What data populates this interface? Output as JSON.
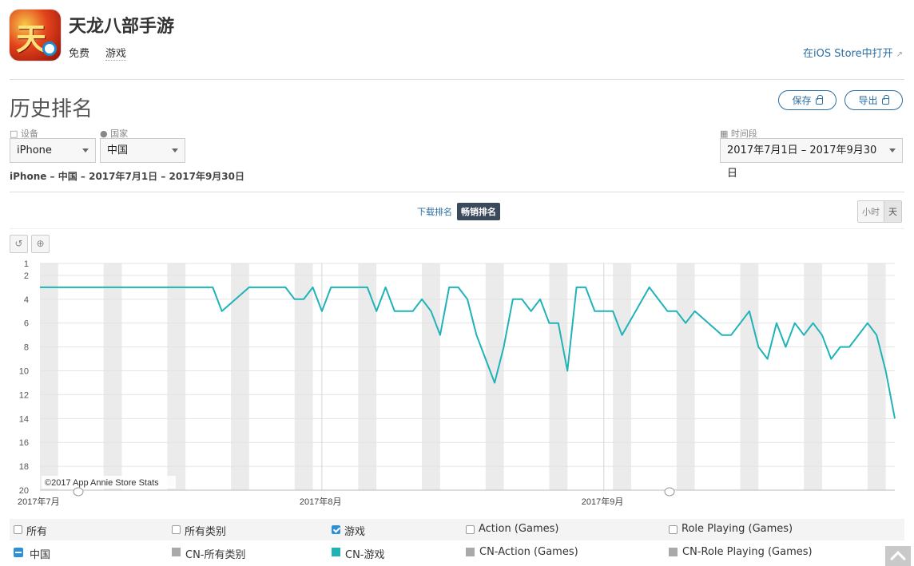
{
  "app": {
    "title": "天龙八部手游",
    "price": "免费",
    "category": "游戏",
    "store_link": "在iOS Store中打开",
    "icon_glyph": "天"
  },
  "page": {
    "section_title": "历史排名",
    "save_label": "保存",
    "export_label": "导出"
  },
  "filters": {
    "device_label": "设备",
    "device_value": "iPhone",
    "country_label": "国家",
    "country_value": "中国",
    "period_label": "时间段",
    "period_value": "2017年7月1日 – 2017年9月30日",
    "summary": "iPhone – 中国 – 2017年7月1日 – 2017年9月30日"
  },
  "tabs": {
    "downloads": "下载排名",
    "grossing": "畅销排名"
  },
  "granularity": {
    "hour": "小时",
    "day": "天"
  },
  "chart_data": {
    "type": "line",
    "credit": "©2017 App Annie Store Stats",
    "x_start": "2017-07-01",
    "x_end": "2017-09-30",
    "x_tick_labels": [
      "2017年7月",
      "2017年8月",
      "2017年9月"
    ],
    "y_tick_labels": [
      "1",
      "2",
      "4",
      "6",
      "8",
      "10",
      "12",
      "14",
      "16",
      "18",
      "20"
    ],
    "ylim": [
      1,
      20
    ],
    "y_inverted": true,
    "grid": true,
    "weekend_bands": true,
    "colors": {
      "line": "#1fb3b8",
      "band": "#ebebeb",
      "grid": "#e3e3e3"
    },
    "series": [
      {
        "name": "CN-游戏",
        "points": [
          [
            "2017-07-01",
            3
          ],
          [
            "2017-07-20",
            3
          ],
          [
            "2017-07-21",
            5
          ],
          [
            "2017-07-24",
            3
          ],
          [
            "2017-07-28",
            3
          ],
          [
            "2017-07-29",
            4
          ],
          [
            "2017-07-30",
            4
          ],
          [
            "2017-07-31",
            3
          ],
          [
            "2017-08-01",
            5
          ],
          [
            "2017-08-02",
            3
          ],
          [
            "2017-08-06",
            3
          ],
          [
            "2017-08-07",
            5
          ],
          [
            "2017-08-08",
            3
          ],
          [
            "2017-08-09",
            5
          ],
          [
            "2017-08-11",
            5
          ],
          [
            "2017-08-12",
            4
          ],
          [
            "2017-08-13",
            5
          ],
          [
            "2017-08-14",
            7
          ],
          [
            "2017-08-15",
            3
          ],
          [
            "2017-08-16",
            3
          ],
          [
            "2017-08-17",
            4
          ],
          [
            "2017-08-18",
            7
          ],
          [
            "2017-08-20",
            11
          ],
          [
            "2017-08-21",
            8
          ],
          [
            "2017-08-22",
            4
          ],
          [
            "2017-08-23",
            4
          ],
          [
            "2017-08-24",
            5
          ],
          [
            "2017-08-25",
            4
          ],
          [
            "2017-08-26",
            6
          ],
          [
            "2017-08-27",
            6
          ],
          [
            "2017-08-28",
            10
          ],
          [
            "2017-08-29",
            3
          ],
          [
            "2017-08-30",
            3
          ],
          [
            "2017-08-31",
            5
          ],
          [
            "2017-09-01",
            5
          ],
          [
            "2017-09-02",
            5
          ],
          [
            "2017-09-03",
            7
          ],
          [
            "2017-09-06",
            3
          ],
          [
            "2017-09-08",
            5
          ],
          [
            "2017-09-09",
            5
          ],
          [
            "2017-09-10",
            6
          ],
          [
            "2017-09-11",
            5
          ],
          [
            "2017-09-14",
            7
          ],
          [
            "2017-09-15",
            7
          ],
          [
            "2017-09-17",
            5
          ],
          [
            "2017-09-18",
            8
          ],
          [
            "2017-09-19",
            9
          ],
          [
            "2017-09-20",
            6
          ],
          [
            "2017-09-21",
            8
          ],
          [
            "2017-09-22",
            6
          ],
          [
            "2017-09-23",
            7
          ],
          [
            "2017-09-24",
            6
          ],
          [
            "2017-09-25",
            7
          ],
          [
            "2017-09-26",
            9
          ],
          [
            "2017-09-27",
            8
          ],
          [
            "2017-09-28",
            8
          ],
          [
            "2017-09-30",
            6
          ],
          [
            "2017-10-01",
            7
          ],
          [
            "2017-10-02",
            10
          ],
          [
            "2017-10-03",
            14
          ]
        ]
      }
    ]
  },
  "legend": {
    "row1": [
      "所有",
      "所有类别",
      "游戏",
      "Action (Games)",
      "Role Playing (Games)"
    ],
    "row1_checked": [
      false,
      false,
      true,
      false,
      false
    ],
    "country": "中国",
    "row2": [
      "CN-所有类别",
      "CN-游戏",
      "CN-Action (Games)",
      "CN-Role Playing (Games)"
    ],
    "row2_colors": [
      "#a9a9a9",
      "#1fb3b8",
      "#a9a9a9",
      "#a9a9a9"
    ]
  }
}
